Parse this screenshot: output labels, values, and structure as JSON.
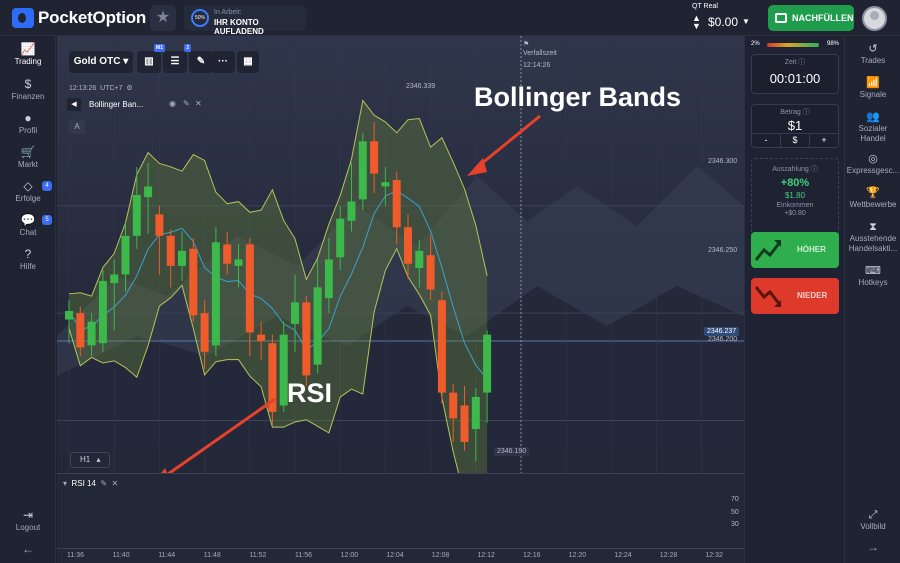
{
  "header": {
    "logo_text": "PocketOption",
    "work_percent": "50%",
    "work_label": "In Arbeit:",
    "work_action": "IHR KONTO AUFLADEND",
    "account_type": "QT Real",
    "balance": "$0.00",
    "topup_label": "NACHFÜLLEN"
  },
  "left_nav": {
    "items": [
      {
        "label": "Trading",
        "icon": "chart-line-icon"
      },
      {
        "label": "Finanzen",
        "icon": "dollar-icon"
      },
      {
        "label": "Profil",
        "icon": "user-icon"
      },
      {
        "label": "Markt",
        "icon": "cart-icon"
      },
      {
        "label": "Erfolge",
        "icon": "diamond-icon",
        "badge": "4"
      },
      {
        "label": "Chat",
        "icon": "chat-icon",
        "badge": "5"
      },
      {
        "label": "Hilfe",
        "icon": "help-icon"
      }
    ],
    "logout": "Logout"
  },
  "right_nav": {
    "items": [
      {
        "label": "Trades",
        "icon": "history-icon"
      },
      {
        "label": "Signale",
        "icon": "signal-icon"
      },
      {
        "label": "Sozialer Handel",
        "icon": "users-icon"
      },
      {
        "label": "Expressgesc...",
        "icon": "target-icon"
      },
      {
        "label": "Wettbewerbe",
        "icon": "trophy-icon"
      },
      {
        "label": "Ausstehende Handelsakti...",
        "icon": "hourglass-icon"
      },
      {
        "label": "Hotkeys",
        "icon": "keyboard-icon"
      }
    ],
    "fullscreen": "Vollbild"
  },
  "trade_panel": {
    "sentiment_left": "2%",
    "sentiment_right": "98%",
    "time_caption": "Zeit",
    "time_value": "00:01:00",
    "amount_caption": "Betrag",
    "amount_value": "$1",
    "minus": "-",
    "currency": "$",
    "plus": "+",
    "payout_caption": "Auszahlung",
    "payout_pct": "+80%",
    "payout_amount": "$1.80",
    "income_caption": "Einkommen",
    "income_amount": "+$0.80",
    "up_label": "HÖHER",
    "down_label": "NIEDER"
  },
  "chart": {
    "asset": "Gold OTC",
    "timeframe_badge": "M1",
    "indicator_badge": "2",
    "clock": "12:13:26",
    "timezone": "UTC+7",
    "indicator_name": "Bollinger Ban...",
    "drawing_tool_label": "A",
    "expiry_label": "Verfallszeit",
    "expiry_time": "12:14:26",
    "high_label": "2346.339",
    "low_label": "2346.190",
    "current_price": "2346.237",
    "price_ticks": [
      "2346.300",
      "2346.250",
      "2346.200"
    ],
    "timeframe_button": "H1",
    "rsi_label": "RSI 14",
    "rsi_levels": [
      "70",
      "50",
      "30"
    ],
    "time_ticks": [
      "11:36",
      "11:40",
      "11:44",
      "11:48",
      "11:52",
      "11:56",
      "12:00",
      "12:04",
      "12:08",
      "12:12",
      "12:16",
      "12:20",
      "12:24",
      "12:28",
      "12:32"
    ]
  },
  "annotations": {
    "bollinger": "Bollinger Bands",
    "rsi": "RSI"
  },
  "colors": {
    "bull": "#3cb94a",
    "bear": "#ef5b2b",
    "band_fill": "#6a8a3a",
    "arrow": "#e8402a",
    "accent": "#2c6cf6"
  },
  "chart_data": {
    "type": "candlestick",
    "candles": [
      {
        "o": 2346.247,
        "c": 2346.251,
        "h": 2346.256,
        "l": 2346.236
      },
      {
        "o": 2346.25,
        "c": 2346.234,
        "h": 2346.253,
        "l": 2346.23
      },
      {
        "o": 2346.235,
        "c": 2346.246,
        "h": 2346.25,
        "l": 2346.23
      },
      {
        "o": 2346.236,
        "c": 2346.265,
        "h": 2346.27,
        "l": 2346.232
      },
      {
        "o": 2346.264,
        "c": 2346.268,
        "h": 2346.275,
        "l": 2346.242
      },
      {
        "o": 2346.268,
        "c": 2346.286,
        "h": 2346.292,
        "l": 2346.26
      },
      {
        "o": 2346.286,
        "c": 2346.305,
        "h": 2346.318,
        "l": 2346.28
      },
      {
        "o": 2346.304,
        "c": 2346.309,
        "h": 2346.32,
        "l": 2346.287
      },
      {
        "o": 2346.296,
        "c": 2346.286,
        "h": 2346.3,
        "l": 2346.268
      },
      {
        "o": 2346.286,
        "c": 2346.272,
        "h": 2346.289,
        "l": 2346.262
      },
      {
        "o": 2346.272,
        "c": 2346.279,
        "h": 2346.288,
        "l": 2346.265
      },
      {
        "o": 2346.28,
        "c": 2346.249,
        "h": 2346.285,
        "l": 2346.246
      },
      {
        "o": 2346.25,
        "c": 2346.232,
        "h": 2346.256,
        "l": 2346.224
      },
      {
        "o": 2346.235,
        "c": 2346.283,
        "h": 2346.29,
        "l": 2346.23
      },
      {
        "o": 2346.282,
        "c": 2346.273,
        "h": 2346.288,
        "l": 2346.268
      },
      {
        "o": 2346.272,
        "c": 2346.275,
        "h": 2346.282,
        "l": 2346.262
      },
      {
        "o": 2346.282,
        "c": 2346.241,
        "h": 2346.285,
        "l": 2346.23
      },
      {
        "o": 2346.24,
        "c": 2346.237,
        "h": 2346.246,
        "l": 2346.228
      },
      {
        "o": 2346.236,
        "c": 2346.204,
        "h": 2346.24,
        "l": 2346.198
      },
      {
        "o": 2346.207,
        "c": 2346.24,
        "h": 2346.246,
        "l": 2346.204
      },
      {
        "o": 2346.245,
        "c": 2346.255,
        "h": 2346.268,
        "l": 2346.232
      },
      {
        "o": 2346.255,
        "c": 2346.221,
        "h": 2346.258,
        "l": 2346.216
      },
      {
        "o": 2346.226,
        "c": 2346.262,
        "h": 2346.275,
        "l": 2346.222
      },
      {
        "o": 2346.257,
        "c": 2346.275,
        "h": 2346.285,
        "l": 2346.25
      },
      {
        "o": 2346.276,
        "c": 2346.294,
        "h": 2346.3,
        "l": 2346.27
      },
      {
        "o": 2346.293,
        "c": 2346.302,
        "h": 2346.32,
        "l": 2346.288
      },
      {
        "o": 2346.303,
        "c": 2346.33,
        "h": 2346.334,
        "l": 2346.298
      },
      {
        "o": 2346.33,
        "c": 2346.315,
        "h": 2346.339,
        "l": 2346.306
      },
      {
        "o": 2346.309,
        "c": 2346.311,
        "h": 2346.318,
        "l": 2346.3
      },
      {
        "o": 2346.312,
        "c": 2346.29,
        "h": 2346.316,
        "l": 2346.282
      },
      {
        "o": 2346.29,
        "c": 2346.273,
        "h": 2346.296,
        "l": 2346.266
      },
      {
        "o": 2346.271,
        "c": 2346.279,
        "h": 2346.284,
        "l": 2346.262
      },
      {
        "o": 2346.277,
        "c": 2346.261,
        "h": 2346.286,
        "l": 2346.256
      },
      {
        "o": 2346.256,
        "c": 2346.213,
        "h": 2346.26,
        "l": 2346.208
      },
      {
        "o": 2346.213,
        "c": 2346.201,
        "h": 2346.217,
        "l": 2346.19
      },
      {
        "o": 2346.207,
        "c": 2346.19,
        "h": 2346.216,
        "l": 2346.186
      },
      {
        "o": 2346.196,
        "c": 2346.211,
        "h": 2346.215,
        "l": 2346.181
      },
      {
        "o": 2346.213,
        "c": 2346.24,
        "h": 2346.242,
        "l": 2346.199
      }
    ]
  }
}
